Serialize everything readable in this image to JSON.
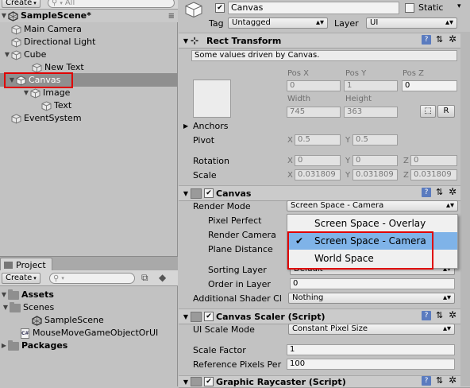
{
  "hierarchy": {
    "create_label": "Create",
    "search_placeholder": "All",
    "scene_name": "SampleScene*",
    "items": [
      {
        "label": "Main Camera"
      },
      {
        "label": "Directional Light"
      },
      {
        "label": "Cube"
      },
      {
        "label": "New Text"
      },
      {
        "label": "Canvas"
      },
      {
        "label": "Image"
      },
      {
        "label": "Text"
      },
      {
        "label": "EventSystem"
      }
    ]
  },
  "project": {
    "tab_label": "Project",
    "create_label": "Create",
    "assets_label": "Assets",
    "scenes_label": "Scenes",
    "sample_scene_label": "SampleScene",
    "script_label": "MouseMoveGameObjectOrUI",
    "packages_label": "Packages"
  },
  "inspector": {
    "object_name": "Canvas",
    "static_label": "Static",
    "tag_label": "Tag",
    "tag_value": "Untagged",
    "layer_label": "Layer",
    "layer_value": "UI",
    "rect_transform": {
      "title": "Rect Transform",
      "notice": "Some values driven by Canvas.",
      "posx_label": "Pos X",
      "posy_label": "Pos Y",
      "posz_label": "Pos Z",
      "posx": "0",
      "posy": "1",
      "posz": "0",
      "width_label": "Width",
      "height_label": "Height",
      "width": "745",
      "height": "363",
      "r_label": "R",
      "anchors_label": "Anchors",
      "pivot_label": "Pivot",
      "pivot_x": "0.5",
      "pivot_y": "0.5",
      "rotation_label": "Rotation",
      "rot_x": "0",
      "rot_y": "0",
      "rot_z": "0",
      "scale_label": "Scale",
      "scale_x": "0.031809",
      "scale_y": "0.031809",
      "scale_z": "0.031809",
      "x_label": "X",
      "y_label": "Y",
      "z_label": "Z"
    },
    "canvas": {
      "title": "Canvas",
      "render_mode_label": "Render Mode",
      "render_mode_value": "Screen Space - Camera",
      "pixel_perfect_label": "Pixel Perfect",
      "render_camera_label": "Render Camera",
      "plane_distance_label": "Plane Distance",
      "sorting_layer_label": "Sorting Layer",
      "sorting_layer_value": "Default",
      "order_in_layer_label": "Order in Layer",
      "order_in_layer_value": "0",
      "additional_shader_label": "Additional Shader Cl",
      "additional_shader_value": "Nothing"
    },
    "canvas_scaler": {
      "title": "Canvas Scaler (Script)",
      "ui_scale_mode_label": "UI Scale Mode",
      "ui_scale_mode_value": "Constant Pixel Size",
      "scale_factor_label": "Scale Factor",
      "scale_factor_value": "1",
      "ref_ppu_label": "Reference Pixels Per",
      "ref_ppu_value": "100"
    },
    "graphic_raycaster": {
      "title": "Graphic Raycaster (Script)"
    }
  },
  "dropdown": {
    "options": [
      "Screen Space - Overlay",
      "Screen Space - Camera",
      "World Space"
    ],
    "selected": "Screen Space - Camera"
  },
  "colors": {
    "highlight_red": "#e00000",
    "menu_highlight": "#7fb3e8",
    "selection_gray": "#8f8f8f"
  }
}
